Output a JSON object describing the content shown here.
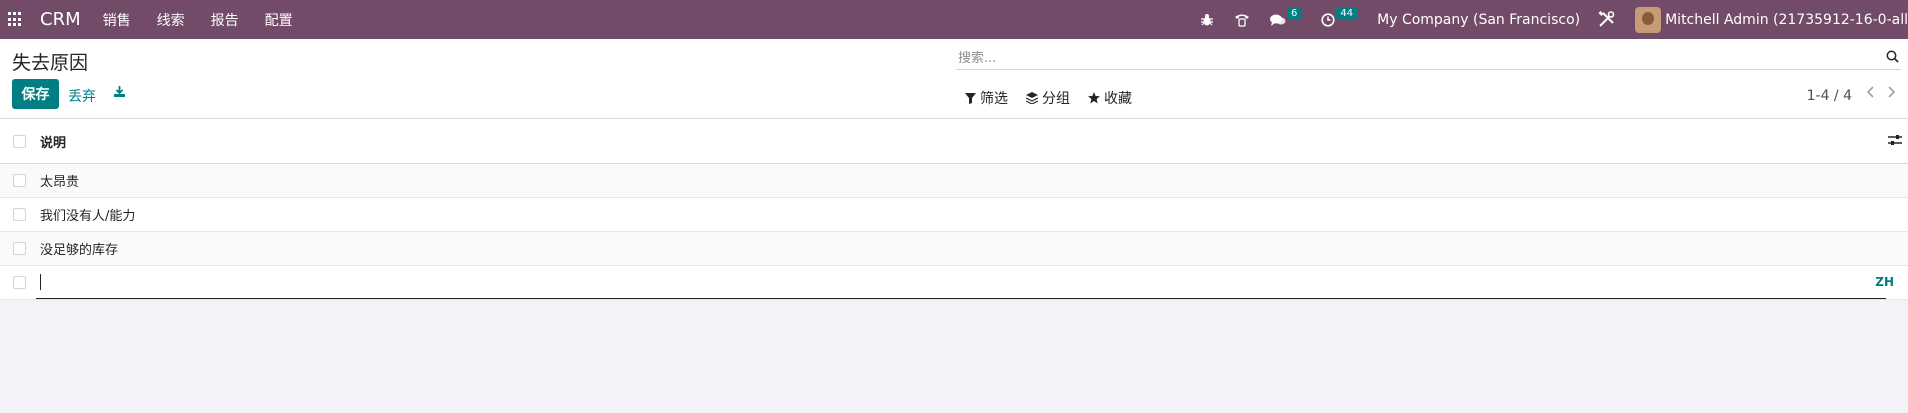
{
  "navbar": {
    "brand": "CRM",
    "menu": [
      "销售",
      "线索",
      "报告",
      "配置"
    ],
    "messages_count": "6",
    "activities_count": "44",
    "company": "My Company (San Francisco)",
    "user": "Mitchell Admin (21735912-16-0-all"
  },
  "control_panel": {
    "title": "失去原因",
    "save_label": "保存",
    "discard_label": "丢弃",
    "search_placeholder": "搜索...",
    "filter_label": "筛选",
    "group_label": "分组",
    "favorites_label": "收藏",
    "pager": "1-4 / 4"
  },
  "list": {
    "column_header": "说明",
    "rows": [
      "太昂贵",
      "我们没有人/能力",
      "没足够的库存"
    ],
    "edit_value": "",
    "lang_code": "ZH"
  },
  "colors": {
    "navbar": "#714B67",
    "primary": "#017e84"
  }
}
